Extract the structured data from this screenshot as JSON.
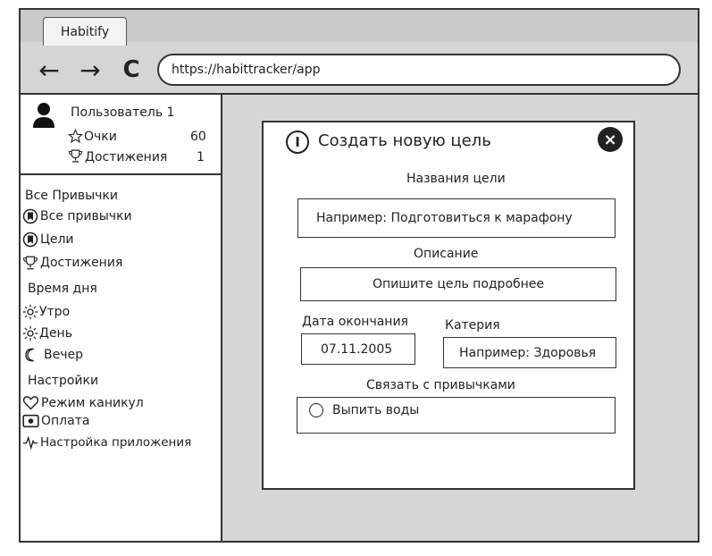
{
  "browser": {
    "tab_title": "Habitify",
    "address": "https://habittracker/app",
    "back_icon": "←",
    "forward_icon": "→",
    "reload_icon": "C"
  },
  "user": {
    "name": "Пользователь 1",
    "points_label": "Очки",
    "points_value": "60",
    "achievements_label": "Достижения",
    "achievements_value": "1"
  },
  "sidebar": {
    "section_all": "Все Привычки",
    "all_habits": "Все привычки",
    "goals": "Цели",
    "achievements": "Достижения",
    "section_time": "Время дня",
    "morning": "Утро",
    "day": "День",
    "evening": "Вечер",
    "section_settings": "Настройки",
    "vacation": "Режим каникул",
    "payment": "Оплата",
    "app_settings": "Настройка приложения"
  },
  "modal": {
    "title": "Создать новую цель",
    "name_label": "Названия цели",
    "name_placeholder": "Например: Подготовиться к марафону",
    "description_label": "Описание",
    "description_placeholder": "Опишите цель подробнее",
    "end_date_label": "Дата окончания",
    "end_date_value": "07.11.2005",
    "category_label": "Катерия",
    "category_placeholder": "Например: Здоровья",
    "link_label": "Связать с привычками",
    "habit_option": "Выпить воды",
    "close_icon": "×",
    "info_icon": "I"
  }
}
